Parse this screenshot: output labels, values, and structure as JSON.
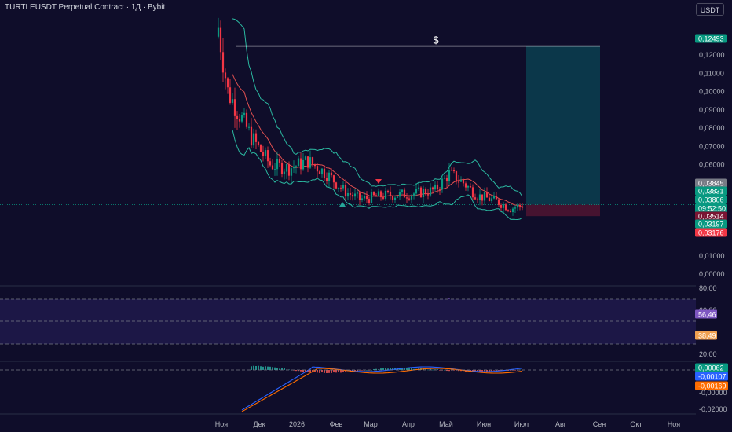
{
  "header": {
    "title": "TURTLEUSDT Perpetual Contract · 1Д · Bybit",
    "currency_button": "USDT"
  },
  "main_chart": {
    "price_ticks": [
      "0,13000",
      "0,12000",
      "0,11000",
      "0,10000",
      "0,09000",
      "0,08000",
      "0,07000",
      "0,06000",
      "0,05000",
      "0,01000",
      "0,00000"
    ],
    "price_values": [
      0.13,
      0.12,
      0.11,
      0.1,
      0.09,
      0.08,
      0.07,
      0.06,
      0.05,
      0.01,
      0.0
    ],
    "target_line_label": "$",
    "target_price": 0.12493,
    "badges": [
      {
        "text": "0,12493",
        "price": 0.12493,
        "color": "#089981"
      },
      {
        "text": "0,03845",
        "price": 0.03845,
        "color": "#787b86"
      },
      {
        "text": "0,03831",
        "price": 0.03831,
        "color": "#089981"
      },
      {
        "text": "0,03806",
        "price": 0.03806,
        "color": "#089981"
      },
      {
        "text": "09:52:50",
        "price": 0.03806,
        "color": "#089981"
      },
      {
        "text": "0,03514",
        "price": 0.03514,
        "color": "#7a1533"
      },
      {
        "text": "0,03197",
        "price": 0.03197,
        "color": "#089981"
      },
      {
        "text": "0,03176",
        "price": 0.03176,
        "color": "#f23645"
      }
    ],
    "colors": {
      "up": "#089981",
      "down": "#f23645",
      "band": "#2bb8a0",
      "mid": "#e05050",
      "target_zone": "#0b3c4e",
      "stop_zone": "#4a1430"
    }
  },
  "rsi_panel": {
    "ticks": [
      "80,00",
      "60,00",
      "20,00"
    ],
    "tick_values": [
      80,
      60,
      20
    ],
    "badges": [
      {
        "text": "56,46",
        "value": 56.46,
        "color": "#7e57c2"
      },
      {
        "text": "38,49",
        "value": 38.49,
        "color": "#f0a050"
      }
    ]
  },
  "macd_panel": {
    "ticks": [
      "-0,00000",
      "-0,02000"
    ],
    "badges": [
      {
        "text": "0,00062",
        "color": "#089981"
      },
      {
        "text": "-0,00107",
        "color": "#2962ff"
      },
      {
        "text": "-0,00169",
        "color": "#ff6d00"
      }
    ]
  },
  "time_axis": {
    "labels": [
      "Ноя",
      "Дек",
      "2026",
      "Фев",
      "Мар",
      "Апр",
      "Май",
      "Июн",
      "Июл",
      "Авг",
      "Сен",
      "Окт",
      "Ноя"
    ]
  }
}
